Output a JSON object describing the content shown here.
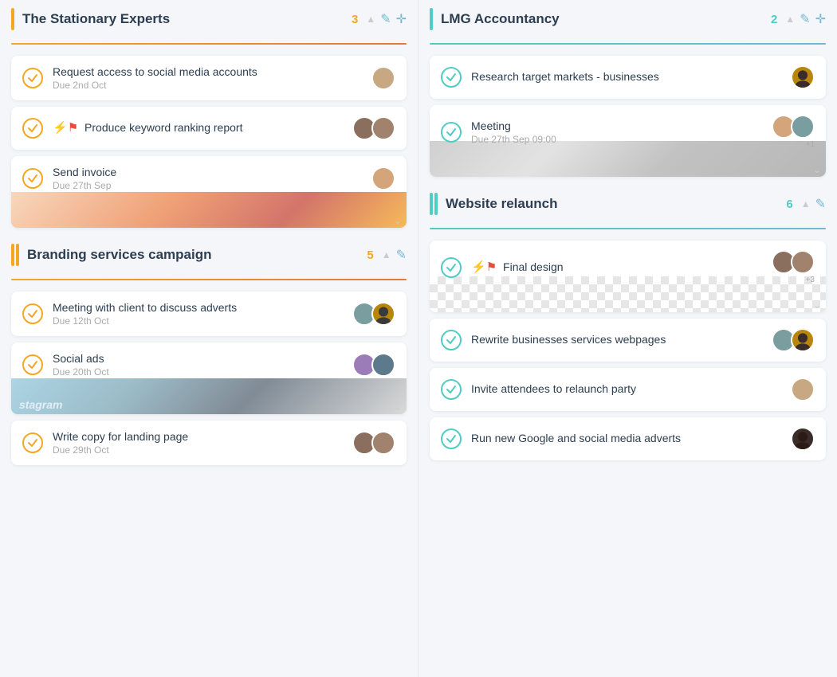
{
  "columns": [
    {
      "id": "col-left",
      "sections": [
        {
          "id": "stationary-experts",
          "title": "The Stationary Experts",
          "count": "3",
          "indicator": "single-orange",
          "divider": "orange",
          "tasks": [
            {
              "id": "task-1",
              "title": "Request access to social media accounts",
              "due": "Due 2nd Oct",
              "avatars": [
                "av1"
              ],
              "hasImage": false,
              "checkColor": "orange",
              "flags": []
            },
            {
              "id": "task-2",
              "title": "Produce keyword ranking report",
              "due": "",
              "avatars": [
                "av2",
                "av3"
              ],
              "hasImage": false,
              "checkColor": "orange",
              "flags": [
                "red",
                "red"
              ]
            },
            {
              "id": "task-3",
              "title": "Send invoice",
              "due": "Due 27th Sep",
              "avatars": [
                "av4"
              ],
              "hasImage": true,
              "imageType": "stationery",
              "checkColor": "orange",
              "flags": []
            }
          ]
        },
        {
          "id": "branding-campaign",
          "title": "Branding services campaign",
          "count": "5",
          "indicator": "double-orange",
          "divider": "orange",
          "tasks": [
            {
              "id": "task-4",
              "title": "Meeting with client to discuss adverts",
              "due": "Due 12th Oct",
              "avatars": [
                "av5",
                "av6"
              ],
              "hasImage": false,
              "checkColor": "orange",
              "flags": []
            },
            {
              "id": "task-5",
              "title": "Social ads",
              "due": "Due 20th Oct",
              "avatars": [
                "av7",
                "av8"
              ],
              "hasImage": true,
              "imageType": "social",
              "checkColor": "orange",
              "flags": []
            },
            {
              "id": "task-6",
              "title": "Write copy for landing page",
              "due": "Due 29th Oct",
              "avatars": [
                "av2",
                "av3"
              ],
              "hasImage": false,
              "checkColor": "orange",
              "flags": []
            }
          ]
        }
      ]
    },
    {
      "id": "col-right",
      "sections": [
        {
          "id": "lmg-accountancy",
          "title": "LMG Accountancy",
          "count": "2",
          "indicator": "single-teal",
          "divider": "teal",
          "tasks": [
            {
              "id": "task-7",
              "title": "Research target markets - businesses",
              "due": "",
              "avatars": [
                "av6"
              ],
              "hasImage": false,
              "checkColor": "teal",
              "flags": []
            },
            {
              "id": "task-8",
              "title": "Meeting",
              "due": "Due 27th Sep 09:00",
              "avatars": [
                "av4",
                "av5"
              ],
              "avatarExtra": "+1",
              "hasImage": true,
              "imageType": "meeting",
              "checkColor": "teal",
              "flags": []
            }
          ]
        },
        {
          "id": "website-relaunch",
          "title": "Website relaunch",
          "count": "6",
          "indicator": "double-teal",
          "divider": "teal",
          "tasks": [
            {
              "id": "task-9",
              "title": "Final design",
              "due": "",
              "avatars": [
                "av2",
                "av3"
              ],
              "avatarExtra": "+3",
              "hasImage": true,
              "imageType": "checkered",
              "checkColor": "teal",
              "flags": [
                "red",
                "red"
              ]
            },
            {
              "id": "task-10",
              "title": "Rewrite businesses services webpages",
              "due": "",
              "avatars": [
                "av5",
                "av6"
              ],
              "hasImage": false,
              "checkColor": "teal",
              "flags": []
            },
            {
              "id": "task-11",
              "title": "Invite attendees to relaunch party",
              "due": "",
              "avatars": [
                "av1"
              ],
              "hasImage": false,
              "checkColor": "teal",
              "flags": []
            },
            {
              "id": "task-12",
              "title": "Run new Google and social media adverts",
              "due": "",
              "avatars": [
                "av6"
              ],
              "hasImage": false,
              "checkColor": "teal",
              "flags": []
            }
          ]
        }
      ]
    }
  ],
  "icons": {
    "arrow_up": "▲",
    "pencil": "✎",
    "plus": "⊕",
    "chevron_down": "⌄",
    "check": "✓",
    "flag": "⚑"
  }
}
